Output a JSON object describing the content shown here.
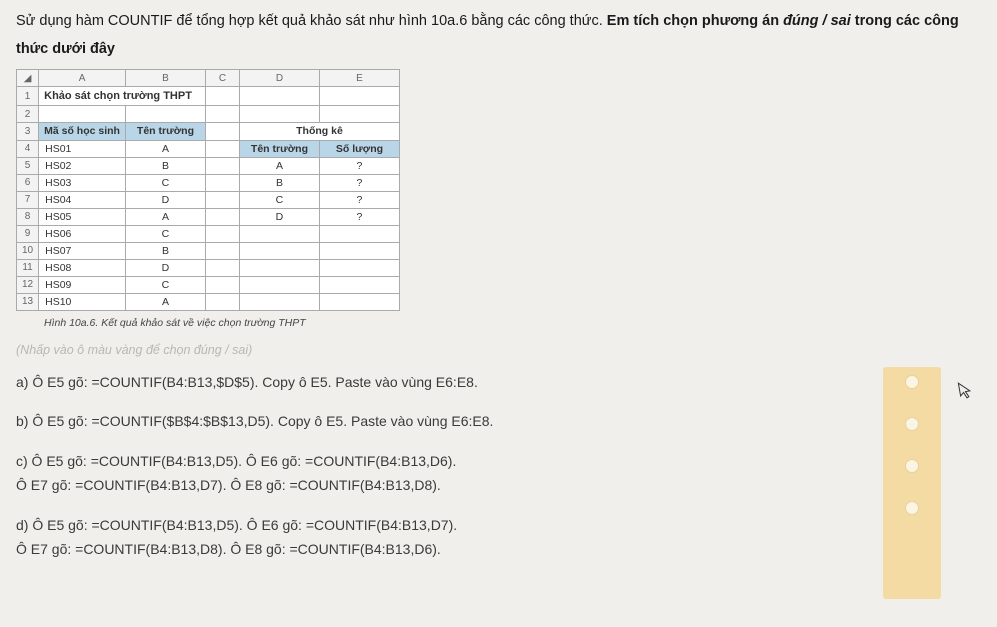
{
  "question": {
    "part1": "Sử dụng hàm COUNTIF để tổng hợp kết quả khảo sát như hình 10a.6 bằng các công thức. ",
    "bold": "Em tích chọn phương án ",
    "boldItalic": "đúng / sai",
    "bold2": " trong các công thức dưới đây"
  },
  "sheet": {
    "colHeaders": [
      "A",
      "B",
      "C",
      "D",
      "E"
    ],
    "title": "Khảo sát chọn trường THPT",
    "header3": {
      "a": "Mã số học sinh",
      "b": "Tên trường",
      "de": "Thống kê"
    },
    "rows": [
      {
        "n": "4",
        "a": "HS01",
        "b": "A"
      },
      {
        "n": "5",
        "a": "HS02",
        "b": "B"
      },
      {
        "n": "6",
        "a": "HS03",
        "b": "C"
      },
      {
        "n": "7",
        "a": "HS04",
        "b": "D"
      },
      {
        "n": "8",
        "a": "HS05",
        "b": "A"
      },
      {
        "n": "9",
        "a": "HS06",
        "b": "C"
      },
      {
        "n": "10",
        "a": "HS07",
        "b": "B"
      },
      {
        "n": "11",
        "a": "HS08",
        "b": "D"
      },
      {
        "n": "12",
        "a": "HS09",
        "b": "C"
      },
      {
        "n": "13",
        "a": "HS10",
        "b": "A"
      }
    ],
    "statHeader": {
      "d": "Tên trường",
      "e": "Số lượng"
    },
    "statRows": [
      {
        "d": "A",
        "e": "?"
      },
      {
        "d": "B",
        "e": "?"
      },
      {
        "d": "C",
        "e": "?"
      },
      {
        "d": "D",
        "e": "?"
      }
    ]
  },
  "caption": "Hình 10a.6. Kết quả khảo sát về việc chọn trường THPT",
  "hint": "(Nhấp vào ô màu vàng để chọn đúng / sai)",
  "options": {
    "a": "a) Ô E5 gõ: =COUNTIF(B4:B13,$D$5). Copy ô E5. Paste vào vùng E6:E8.",
    "b": "b) Ô E5 gõ: =COUNTIF($B$4:$B$13,D5). Copy ô E5. Paste vào vùng E6:E8.",
    "c1": "c) Ô E5 gõ: =COUNTIF(B4:B13,D5). Ô E6 gõ: =COUNTIF(B4:B13,D6).",
    "c2": "Ô E7 gõ: =COUNTIF(B4:B13,D7). Ô E8 gõ: =COUNTIF(B4:B13,D8).",
    "d1": "d) Ô E5 gõ: =COUNTIF(B4:B13,D5). Ô E6 gõ: =COUNTIF(B4:B13,D7).",
    "d2": "Ô E7 gõ: =COUNTIF(B4:B13,D8). Ô E8 gõ: =COUNTIF(B4:B13,D6)."
  }
}
